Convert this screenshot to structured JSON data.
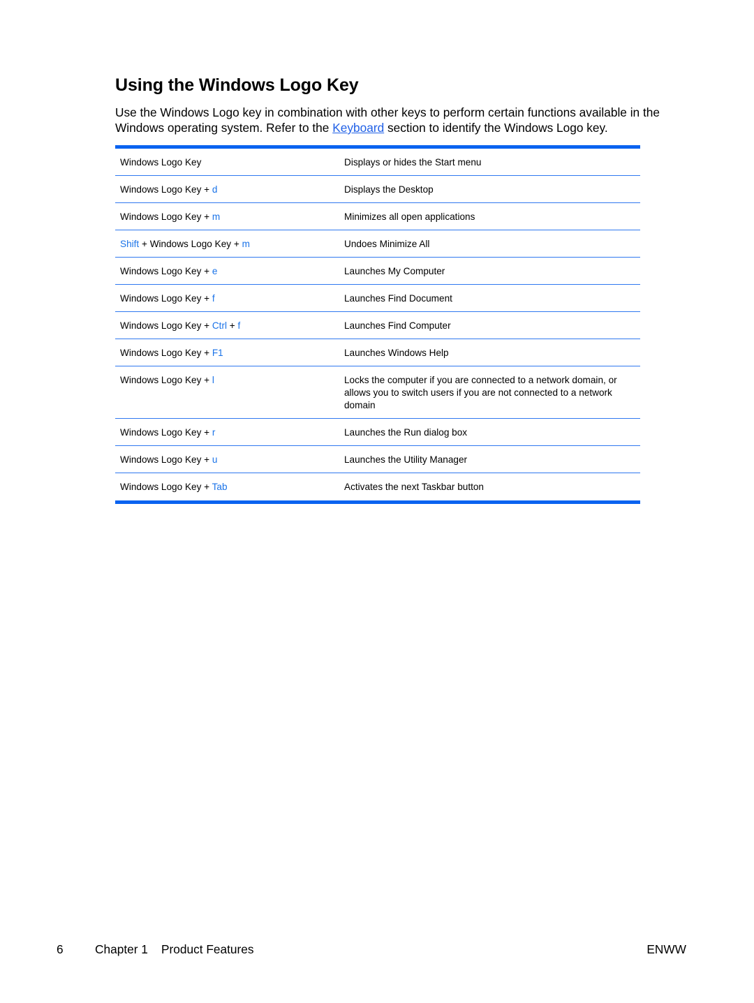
{
  "document": {
    "title": "Using the Windows Logo Key",
    "intro": {
      "text_before_link": "Use the Windows Logo key in combination with other keys to perform certain functions available in the Windows operating system. Refer to the ",
      "link_text": "Keyboard",
      "text_after_link": " section to identify the Windows Logo key."
    },
    "colors": {
      "accent": "#1a73e8",
      "table_rule": "#0a63f0"
    },
    "shortcuts": [
      {
        "key_parts": [
          {
            "text": "Windows Logo Key",
            "accent": false
          }
        ],
        "description": "Displays or hides the Start menu"
      },
      {
        "key_parts": [
          {
            "text": "Windows Logo Key + ",
            "accent": false
          },
          {
            "text": "d",
            "accent": true
          }
        ],
        "description": "Displays the Desktop"
      },
      {
        "key_parts": [
          {
            "text": "Windows Logo Key + ",
            "accent": false
          },
          {
            "text": "m",
            "accent": true
          }
        ],
        "description": "Minimizes all open applications"
      },
      {
        "key_parts": [
          {
            "text": "Shift",
            "accent": true
          },
          {
            "text": " + Windows Logo Key + ",
            "accent": false
          },
          {
            "text": "m",
            "accent": true
          }
        ],
        "description": "Undoes Minimize All"
      },
      {
        "key_parts": [
          {
            "text": "Windows Logo Key + ",
            "accent": false
          },
          {
            "text": "e",
            "accent": true
          }
        ],
        "description": "Launches My Computer"
      },
      {
        "key_parts": [
          {
            "text": "Windows Logo Key + ",
            "accent": false
          },
          {
            "text": "f",
            "accent": true
          }
        ],
        "description": "Launches Find Document"
      },
      {
        "key_parts": [
          {
            "text": "Windows Logo Key + ",
            "accent": false
          },
          {
            "text": "Ctrl",
            "accent": true
          },
          {
            "text": " + ",
            "accent": false
          },
          {
            "text": "f",
            "accent": true
          }
        ],
        "description": "Launches Find Computer"
      },
      {
        "key_parts": [
          {
            "text": "Windows Logo Key + ",
            "accent": false
          },
          {
            "text": "F1",
            "accent": true
          }
        ],
        "description": "Launches Windows Help"
      },
      {
        "key_parts": [
          {
            "text": "Windows Logo Key + ",
            "accent": false
          },
          {
            "text": "l",
            "accent": true
          }
        ],
        "description": "Locks the computer if you are connected to a network domain, or allows you to switch users if you are not connected to a network domain"
      },
      {
        "key_parts": [
          {
            "text": "Windows Logo Key + ",
            "accent": false
          },
          {
            "text": "r",
            "accent": true
          }
        ],
        "description": "Launches the Run dialog box"
      },
      {
        "key_parts": [
          {
            "text": "Windows Logo Key + ",
            "accent": false
          },
          {
            "text": "u",
            "accent": true
          }
        ],
        "description": "Launches the Utility Manager"
      },
      {
        "key_parts": [
          {
            "text": "Windows Logo Key + ",
            "accent": false
          },
          {
            "text": "Tab",
            "accent": true
          }
        ],
        "description": "Activates the next Taskbar button"
      }
    ]
  },
  "footer": {
    "page_number": "6",
    "chapter_label": "Chapter 1",
    "chapter_title": "Product Features",
    "locale_code": "ENWW"
  }
}
